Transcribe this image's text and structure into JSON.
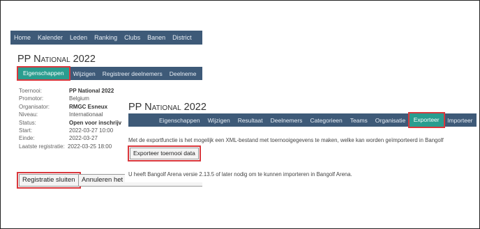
{
  "back_panel": {
    "top_nav": [
      "Home",
      "Kalender",
      "Leden",
      "Ranking",
      "Clubs",
      "Banen",
      "District"
    ],
    "title_prefix": "PP ",
    "title_name": "National",
    "title_year": " 2022",
    "sub_nav": [
      {
        "label": "Eigenschappen",
        "active": true
      },
      {
        "label": "Wijzigen",
        "active": false
      },
      {
        "label": "Registreer deelnemers",
        "active": false
      },
      {
        "label": "Deelneme",
        "active": false
      }
    ],
    "properties": [
      {
        "key": "Toernooi:",
        "value": "PP National 2022",
        "bold": true
      },
      {
        "key": "Promotor:",
        "value": "Belgium",
        "bold": false
      },
      {
        "key": "Organisator:",
        "value": "RMGC Esneux",
        "bold": true
      },
      {
        "key": "Niveau:",
        "value": "Internationaal",
        "bold": false
      },
      {
        "key": "Status:",
        "value": "Open voor inschrijv",
        "bold": true
      },
      {
        "key": "Start:",
        "value": "2022-03-27 10:00",
        "bold": false
      },
      {
        "key": "Einde:",
        "value": "2022-03-27",
        "bold": false
      },
      {
        "key": "Laatste registratie:",
        "value": "2022-03-25 18:00",
        "bold": false
      }
    ],
    "close_button": "Registratie sluiten",
    "cancel_button": "Annuleren het o"
  },
  "front_panel": {
    "title_prefix": "PP ",
    "title_name": "National",
    "title_year": " 2022",
    "sub_nav": [
      {
        "label": "Eigenschappen",
        "active": false
      },
      {
        "label": "Wijzigen",
        "active": false
      },
      {
        "label": "Resultaat",
        "active": false
      },
      {
        "label": "Deelnemers",
        "active": false
      },
      {
        "label": "Categorieen",
        "active": false
      },
      {
        "label": "Teams",
        "active": false
      },
      {
        "label": "Organisatie",
        "active": false
      },
      {
        "label": "Exporteer",
        "active": true
      },
      {
        "label": "Importeer",
        "active": false
      }
    ],
    "description": "Met de exportfunctie is het mogelijk een XML-bestand met toernooigegevens te maken, welke kan worden geïmporteerd in Bangolf",
    "export_button": "Exporteer toernooi data",
    "note": "U heeft Bangolf Arena versie 2.13.5 of later nodig om te kunnen importeren in Bangolf Arena."
  },
  "colors": {
    "nav_bg": "#3e5a78",
    "active_tab": "#2a9d8f",
    "highlight": "#d9373c"
  }
}
